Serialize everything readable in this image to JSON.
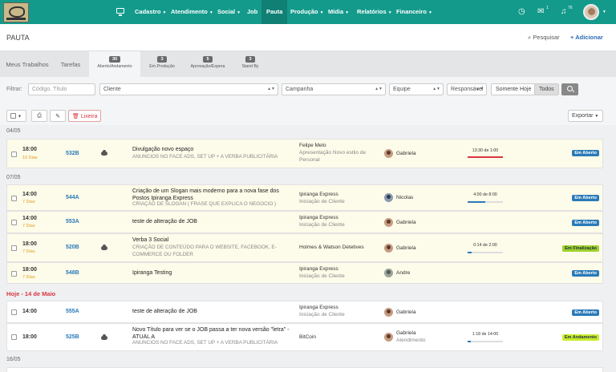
{
  "nav": {
    "items": [
      {
        "label": "Cadastro",
        "dropdown": true
      },
      {
        "label": "Atendimento",
        "dropdown": true
      },
      {
        "label": "Social",
        "dropdown": true
      },
      {
        "label": "Job",
        "dropdown": false
      },
      {
        "label": "Pauta",
        "dropdown": false,
        "active": true
      },
      {
        "label": "Produção",
        "dropdown": true
      },
      {
        "label": "Mídia",
        "dropdown": true
      },
      {
        "label": "Relatórios",
        "dropdown": true
      },
      {
        "label": "Financeiro",
        "dropdown": true
      }
    ],
    "mail_count": "1",
    "notif_count": "76",
    "brand_color": "#139a8b"
  },
  "header": {
    "title": "PAUTA",
    "search_label": "Pesquisar",
    "add_label": "Adicionar"
  },
  "tabs": [
    {
      "label": "Meus Trabalhos"
    },
    {
      "label": "Tarefas"
    },
    {
      "count": "30",
      "label": "Aberto/Andamento",
      "active": true
    },
    {
      "count": "3",
      "label": "Em Produção"
    },
    {
      "count": "5",
      "label": "Aprovação/Espera"
    },
    {
      "count": "3",
      "label": "Stand By"
    }
  ],
  "filters": {
    "label": "Filtrar:",
    "code_placeholder": "Código, Título",
    "cliente": "Cliente",
    "campanha": "Campanha",
    "equipe": "Equipe",
    "responsavel": "Responsável",
    "somente_hoje": "Somente Hoje",
    "todos": "Todos"
  },
  "toolbar": {
    "lixeira": "Lixeira",
    "exportar": "Exportar"
  },
  "groups": [
    {
      "date": "04/05",
      "today": false,
      "rows": [
        {
          "time": "18:00",
          "days": "10 Dias",
          "code": "532B",
          "cloud": true,
          "title": "Divulgação novo espaço",
          "subtitle": "ANUNCIOS NO FACE ADS, SET UP + A VERBA PUBLICITÁRIA",
          "client": "Felipe Melo",
          "client_sub": "Apresentação Novo estilo de Personal",
          "person": "Gabriela",
          "person_sub": "",
          "progress_text": "13:30 de 1:00",
          "progress": 1.0,
          "progress_color": "red",
          "status": "Em Aberto",
          "status_color": "blue",
          "highlight": true
        }
      ]
    },
    {
      "date": "07/05",
      "today": false,
      "rows": [
        {
          "time": "14:00",
          "days": "7 Dias",
          "code": "544A",
          "cloud": false,
          "title": "Criação de um Slogan mais moderno para a nova fase dos Postos Ipiranga Express",
          "subtitle": "CRIAÇÃO DE SLOGAN ( FRASE QUE EXPLICA O NEGOCIO )",
          "client": "Ipiranga Express",
          "client_sub": "Iniciação de Cliente",
          "person": "Nicolas",
          "person_sub": "",
          "progress_text": "4:00 de 8:00",
          "progress": 0.5,
          "progress_color": "blue",
          "status": "Em Aberto",
          "status_color": "blue",
          "highlight": true
        },
        {
          "time": "14:00",
          "days": "7 Dias",
          "code": "553A",
          "cloud": false,
          "title": "teste de alteração de JOB",
          "subtitle": "",
          "client": "Ipiranga Express",
          "client_sub": "Iniciação de Cliente",
          "person": "Gabriela",
          "person_sub": "",
          "progress_text": "",
          "progress": null,
          "progress_color": "",
          "status": "Em Aberto",
          "status_color": "blue",
          "highlight": true
        },
        {
          "time": "18:00",
          "days": "7 Dias",
          "code": "520B",
          "cloud": true,
          "title": "Verba 3 Social",
          "subtitle": "CRIAÇÃO DE CONTEÚDO PARA O WEBSITE, FACEBOOK, E-COMMERCE OU FOLDER",
          "client": "Holmes & Watson Detetives",
          "client_sub": "",
          "person": "Gabriela",
          "person_sub": "",
          "progress_text": "0:14 de 2:00",
          "progress": 0.12,
          "progress_color": "blue",
          "status": "Em Finalização",
          "status_color": "green",
          "highlight": true
        },
        {
          "time": "18:00",
          "days": "7 Dias",
          "code": "548B",
          "cloud": false,
          "title": "Ipiranga Testing",
          "subtitle": "",
          "client": "Ipiranga Express",
          "client_sub": "Iniciação de Cliente",
          "person": "Andre",
          "person_sub": "",
          "progress_text": "",
          "progress": null,
          "progress_color": "",
          "status": "Em Aberto",
          "status_color": "blue",
          "highlight": true
        }
      ]
    },
    {
      "date": "Hoje - 14 de Maio",
      "today": true,
      "rows": [
        {
          "time": "14:00",
          "days": "",
          "code": "555A",
          "cloud": false,
          "title": "teste de alteração de JOB",
          "subtitle": "",
          "client": "Ipiranga Express",
          "client_sub": "Iniciação de Cliente",
          "person": "Gabriela",
          "person_sub": "",
          "progress_text": "",
          "progress": null,
          "progress_color": "",
          "status": "Em Aberto",
          "status_color": "blue",
          "highlight": false
        },
        {
          "time": "18:00",
          "days": "",
          "code": "525B",
          "cloud": true,
          "title": "Novo Título para ver se o JOB passa a ter nova versão \"letra\" - ATUAL A",
          "subtitle": "ANUNCIOS NO FACE ADS, SET UP + A VERBA PUBLICITÁRIA",
          "client": "BitCoin",
          "client_sub": "",
          "person": "Gabriela",
          "person_sub": "Atendimento",
          "progress_text": "1:18 de 14:00",
          "progress": 0.09,
          "progress_color": "blue",
          "status": "Em Andamento",
          "status_color": "lime",
          "highlight": false
        }
      ]
    },
    {
      "date": "16/05",
      "today": false,
      "rows": []
    }
  ]
}
